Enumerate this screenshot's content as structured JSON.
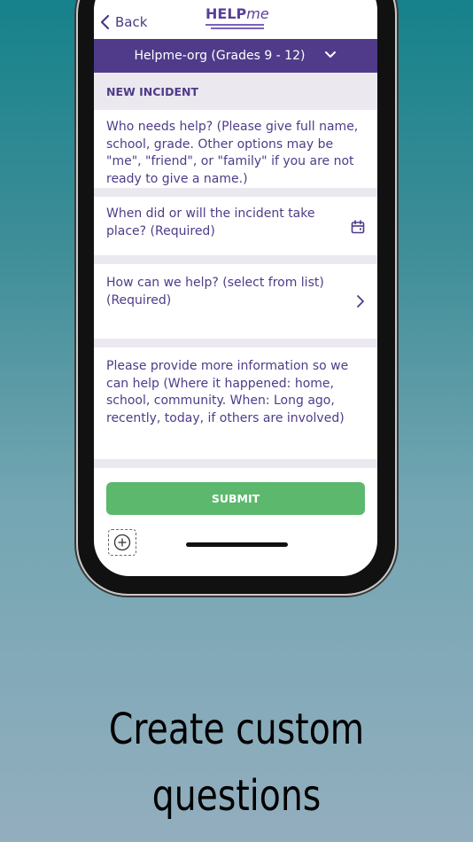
{
  "nav": {
    "back_label": "Back"
  },
  "logo": {
    "text_bold": "HELP",
    "text_light": "me"
  },
  "org_selector": {
    "label": "Helpme-org (Grades 9 - 12)"
  },
  "form": {
    "section_title": "NEW INCIDENT",
    "fields": [
      {
        "placeholder": "Who needs help? (Please give full name, school, grade. Other options may be \"me\", \"friend\", or \"family\" if you are not ready to give a name.)",
        "icon": ""
      },
      {
        "placeholder": "When did or will the incident take place? (Required)",
        "icon": "calendar-icon"
      },
      {
        "placeholder": "How can we help? (select from list) (Required)",
        "icon": "chevron-right-icon"
      },
      {
        "placeholder": "Please provide more information so we can help (Where it happened: home, school, community. When: Long ago, recently, today, if others are involved)",
        "icon": ""
      }
    ],
    "submit_label": "SUBMIT"
  },
  "caption": {
    "line1": "Create custom",
    "line2": "questions"
  },
  "colors": {
    "brand_purple": "#4f3b89",
    "submit_green": "#5cb86d",
    "section_bg": "#ebe9ef"
  }
}
